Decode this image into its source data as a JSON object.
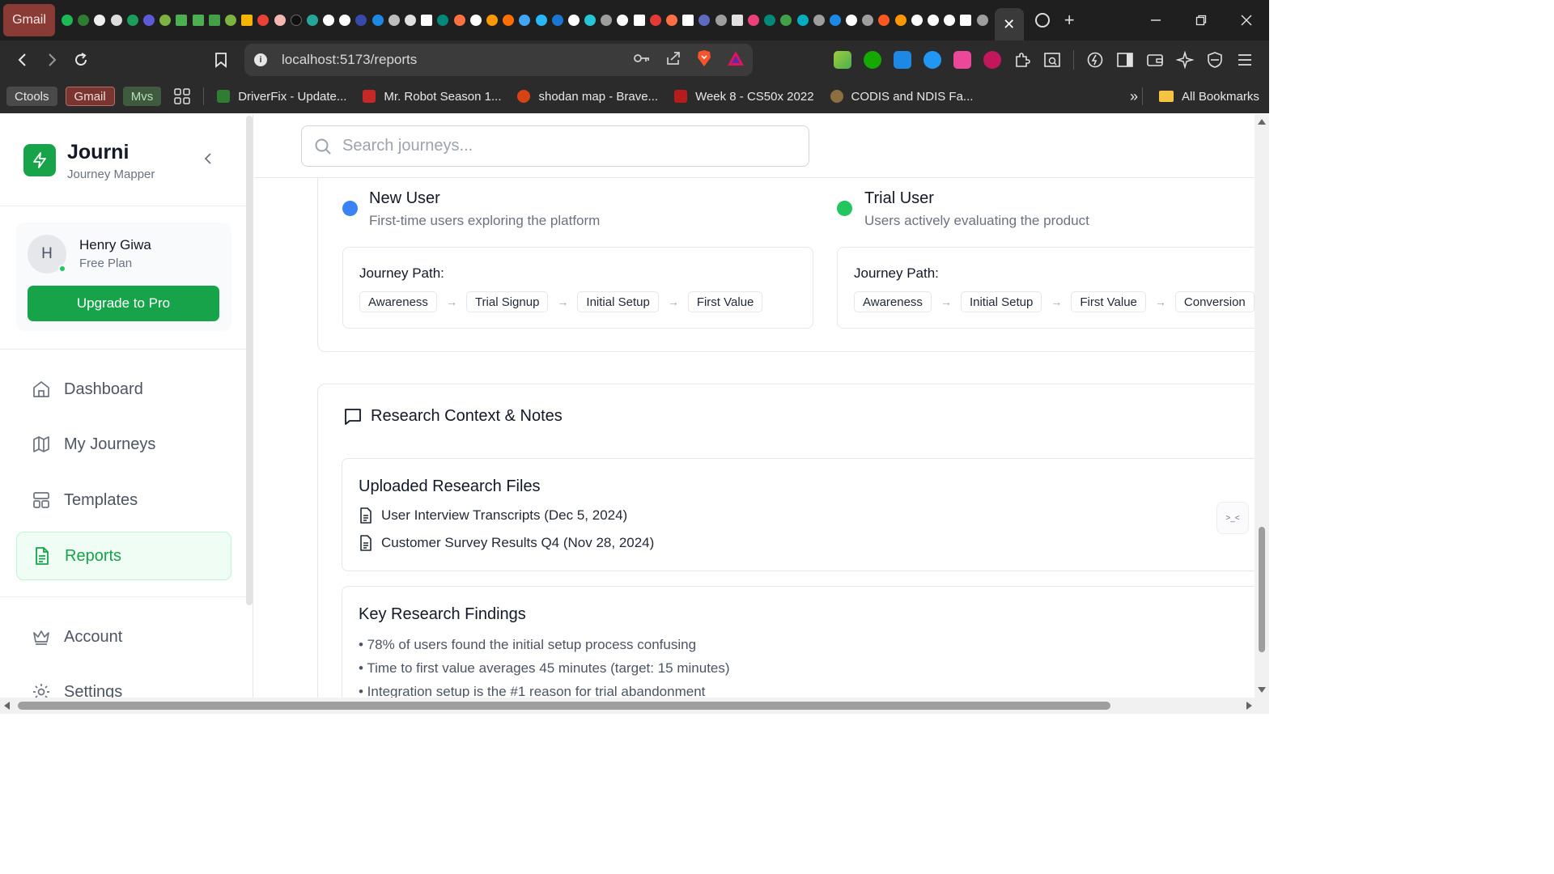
{
  "browser": {
    "pinned_tab_label": "Gmail",
    "active_tab_close": "✕",
    "url": "localhost:5173/reports",
    "bookmarks": {
      "chips": [
        "Ctools",
        "Gmail",
        "Mvs"
      ],
      "items": [
        "DriverFix - Update...",
        "Mr. Robot Season 1...",
        "shodan map - Brave...",
        "Week 8 - CS50x 2022",
        "CODIS and NDIS Fa..."
      ],
      "overflow": "»",
      "all_bookmarks": "All Bookmarks"
    },
    "colors": {
      "tab_bar": "#1f1f1f",
      "toolbar": "#2b2b2b",
      "gmail_tab": "#8a3b35"
    }
  },
  "sidebar": {
    "app_name": "Journi",
    "app_subtitle": "Journey Mapper",
    "user": {
      "initial": "H",
      "name": "Henry Giwa",
      "plan": "Free Plan"
    },
    "upgrade_label": "Upgrade to Pro",
    "nav": [
      {
        "label": "Dashboard",
        "icon": "home-icon",
        "active": false
      },
      {
        "label": "My Journeys",
        "icon": "map-icon",
        "active": false
      },
      {
        "label": "Templates",
        "icon": "layout-icon",
        "active": false
      },
      {
        "label": "Reports",
        "icon": "file-text-icon",
        "active": true
      }
    ],
    "secondary_nav": [
      {
        "label": "Account",
        "icon": "crown-icon"
      },
      {
        "label": "Settings",
        "icon": "gear-icon"
      }
    ]
  },
  "main": {
    "search_placeholder": "Search journeys...",
    "personas": [
      {
        "title": "New User",
        "description": "First-time users exploring the platform",
        "color": "#3b82f6",
        "path_label": "Journey Path:",
        "steps": [
          "Awareness",
          "Trial Signup",
          "Initial Setup",
          "First Value"
        ]
      },
      {
        "title": "Trial User",
        "description": "Users actively evaluating the product",
        "color": "#22c55e",
        "path_label": "Journey Path:",
        "steps": [
          "Awareness",
          "Initial Setup",
          "First Value",
          "Conversion"
        ]
      }
    ],
    "notes": {
      "title": "Research Context & Notes",
      "files_title": "Uploaded Research Files",
      "files": [
        "User Interview Transcripts (Dec 5, 2024)",
        "Customer Survey Results Q4 (Nov 28, 2024)"
      ],
      "findings_title": "Key Research Findings",
      "findings": [
        "• 78% of users found the initial setup process confusing",
        "• Time to first value averages 45 minutes (target: 15 minutes)",
        "• Integration setup is the #1 reason for trial abandonment"
      ]
    },
    "accent": "#16a34a"
  }
}
